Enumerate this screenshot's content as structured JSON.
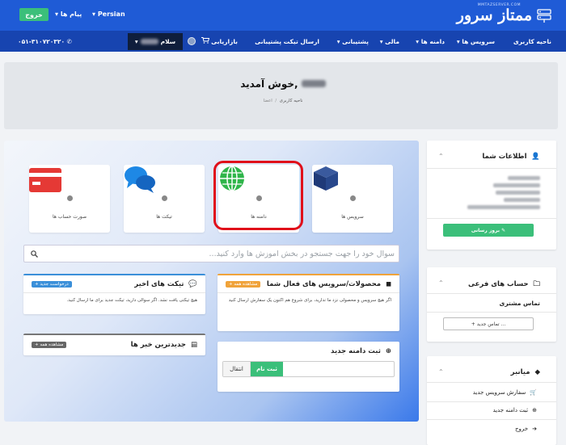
{
  "topbar": {
    "logo_text": "ممتاز سرور",
    "logo_sub": "MMTAZSERVER.COM",
    "logout_label": "خروج",
    "messages_label": "پیام ها",
    "language_label": "Persian"
  },
  "nav": {
    "items": [
      "ناحیه کاربری",
      "سرویس ها",
      "دامنه ها",
      "مالی",
      "پشتیبانی",
      "ارسال تیکت پشتیبانی",
      "بازاریابی"
    ],
    "hello_label": "سلام",
    "phone": "۰۵۱-۳۱۰۷۲۰۳۲۰"
  },
  "header": {
    "welcome": "خوش آمدید,",
    "breadcrumb_home": "اعضا",
    "breadcrumb_current": "ناحیه کاربری"
  },
  "tiles": {
    "services": "سرویس ها",
    "domains": "دامنه ها",
    "tickets": "تیکت ها",
    "invoices": "صورت حساب ها"
  },
  "kb": {
    "placeholder": "سوال خود را جهت جستجو در بخش آموزش ها وارد کنید..."
  },
  "cards": {
    "products": {
      "title": "محصولات/سرویس های فعال شما",
      "badge": "+ مشاهده همه",
      "body": "اگر هیچ سرویس و محصولی نزد ما ندارید، برای شروع هم اکنون یک سفارش ارسال کنید"
    },
    "tickets": {
      "title": "تیکت های اخیر",
      "badge": "+ درخواست جدید",
      "body": "هیچ تیکتی یافت نشد. اگر سوالی دارید، تیکت جدید برای ما ارسال کنید."
    },
    "news": {
      "title": "جدیدترین خبر ها",
      "badge": "+ مشاهده همه"
    },
    "domain_register": {
      "title": "ثبت دامنه جدید",
      "register_button": "ثبت نام",
      "transfer_button": "انتقال"
    }
  },
  "sidebar": {
    "info_title": "اطلاعات شما",
    "update_button": "بروز رسانی",
    "sub_title": "حساب های فرعی",
    "contact_label": "تماس مشتری",
    "new_contact_button": "+ تماس جدید ...",
    "menu_title": "میانبر",
    "menu_items": [
      "سفارش سرویس جدید",
      "ثبت دامنه جدید",
      "خروج"
    ]
  },
  "colors": {
    "topbar": "#1f5bd6",
    "navbar": "#1744b0",
    "accent_green": "#3bbf7a",
    "highlight_red": "#e0101a"
  }
}
